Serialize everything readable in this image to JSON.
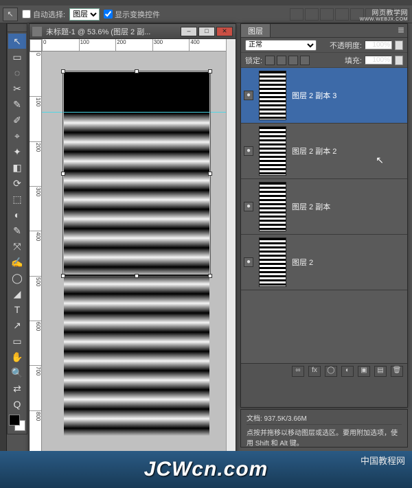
{
  "options": {
    "auto_select_label": "自动选择:",
    "auto_select_value": "图层",
    "show_transform_label": "显示变换控件",
    "watermark_top_line1": "网页教学网",
    "watermark_top_line2": "WWW.WEBJX.COM"
  },
  "tools": [
    "↖",
    "▭",
    "◌",
    "✂",
    "✎",
    "✐",
    "⌖",
    "✦",
    "◧",
    "⟳",
    "⬚",
    "◐",
    "✎",
    "⤧",
    "✍",
    "◯",
    "◢",
    "T",
    "↗",
    "▭",
    "✋",
    "🔍",
    "⇄",
    "Q"
  ],
  "document": {
    "title": "未标题-1 @ 53.6% (图层 2 副...",
    "zoom": "53.56%",
    "ruler_h": [
      "0",
      "100",
      "200",
      "300",
      "400"
    ],
    "ruler_v": [
      "0",
      "100",
      "200",
      "300",
      "400",
      "500",
      "600",
      "700",
      "800"
    ]
  },
  "layers_panel": {
    "tab": "图层",
    "blend_mode": "正常",
    "opacity_label": "不透明度:",
    "opacity_value": "100%",
    "lock_label": "锁定:",
    "fill_label": "填充:",
    "fill_value": "100%",
    "layers": [
      {
        "name": "图层 2 副本 3",
        "selected": true
      },
      {
        "name": "图层 2 副本 2",
        "selected": false
      },
      {
        "name": "图层 2 副本",
        "selected": false
      },
      {
        "name": "图层 2",
        "selected": false
      }
    ]
  },
  "info": {
    "doc_size": "文档: 937.5K/3.66M",
    "hint": "点按并拖移以移动图层或选区。要用附加选项，使用 Shift 和 Alt 键。"
  },
  "bottom": {
    "small": "中国教程网",
    "big": "JCWcn.com"
  }
}
